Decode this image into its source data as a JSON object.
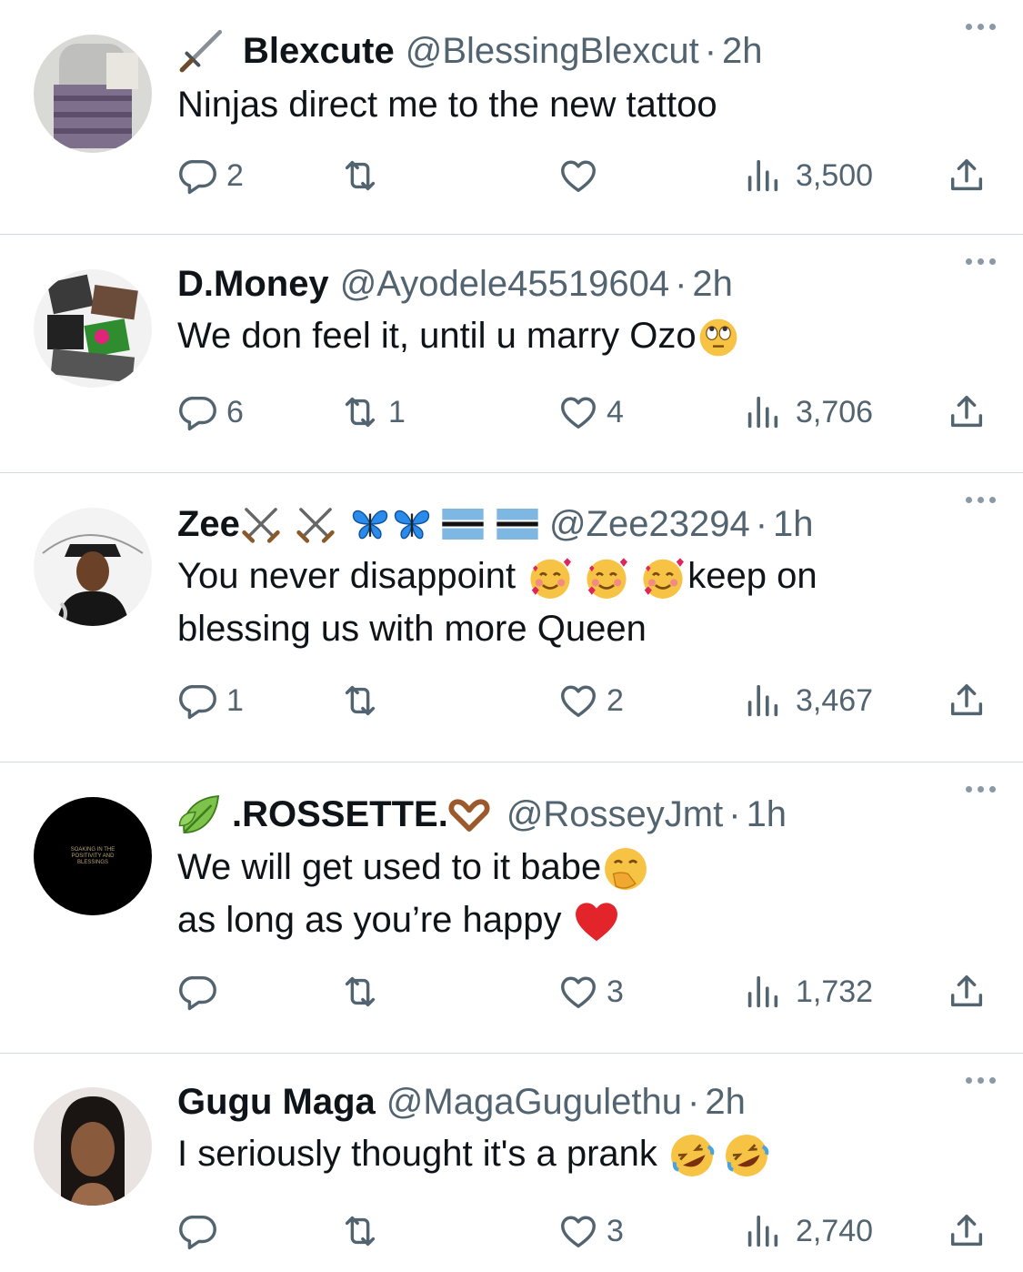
{
  "tweets": [
    {
      "prefix_emoji": "dagger-icon",
      "name": "Blexcute",
      "handle": "@BlessingBlexcut",
      "time": "2h",
      "lines": [
        "Ninjas direct me to the new tattoo"
      ],
      "replies": "2",
      "retweets": "",
      "likes": "",
      "views": "3,500"
    },
    {
      "name": "D.Money",
      "handle": "@Ayodele45519604",
      "time": "2h",
      "lines": [
        "We don feel it, until u marry Ozo"
      ],
      "suffix_emoji": "eye-roll-emoji",
      "replies": "6",
      "retweets": "1",
      "likes": "4",
      "views": "3,706"
    },
    {
      "name": "Zee",
      "handle": "@Zee23294",
      "time": "1h",
      "name_emojis": [
        "crossed-swords-icon",
        "crossed-swords-icon",
        "butterfly-icon",
        "butterfly-icon",
        "botswana-flag-icon",
        "botswana-flag-icon"
      ],
      "lines": [
        "You never disappoint ",
        "keep on",
        "blessing us with more Queen"
      ],
      "replies": "1",
      "retweets": "",
      "likes": "2",
      "views": "3,467"
    },
    {
      "prefix_emoji": "leaf-icon",
      "name": ".ROSSETTE.",
      "handle": "@RosseyJmt",
      "time": "1h",
      "lines": [
        "We will get used to it babe",
        "as long as you’re happy "
      ],
      "avatar_text": "SOAKING IN THE POSITIVITY AND BLESSINGS",
      "replies": "",
      "retweets": "",
      "likes": "3",
      "views": "1,732"
    },
    {
      "name": "Gugu Maga",
      "handle": "@MagaGugulethu",
      "time": "2h",
      "lines": [
        "I seriously thought it's a prank "
      ],
      "replies": "",
      "retweets": "",
      "likes": "3",
      "views": "2,740"
    }
  ],
  "separator": "·",
  "colors": {
    "text": "#0f1419",
    "secondary": "#536471",
    "divider": "#cfd9de"
  }
}
